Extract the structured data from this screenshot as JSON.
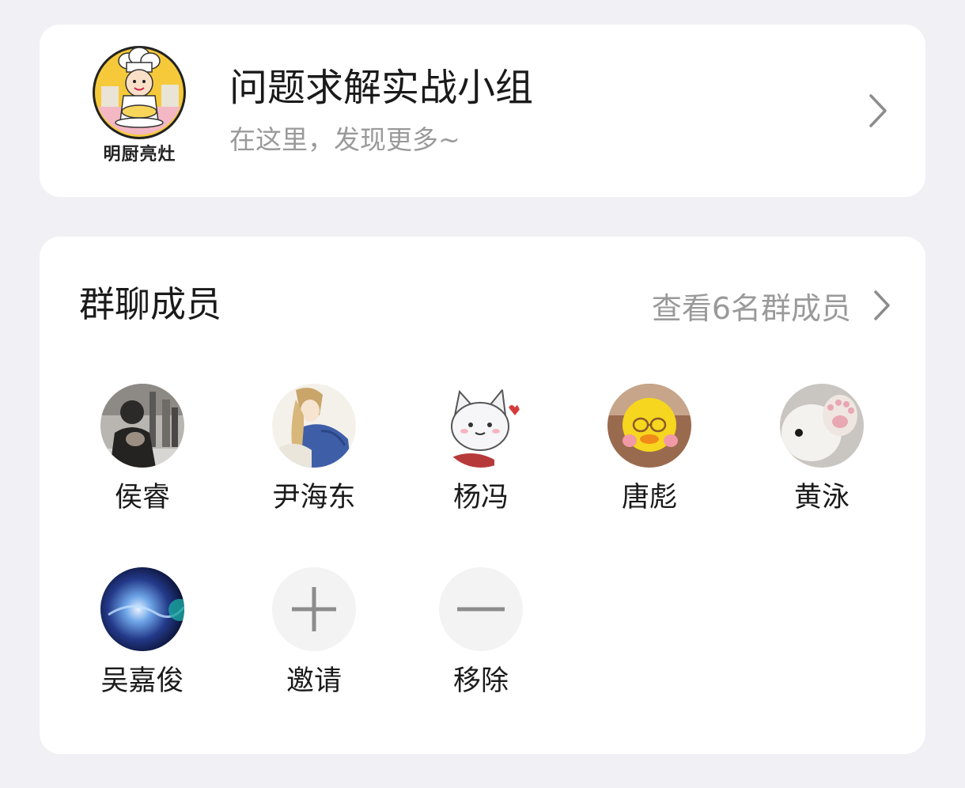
{
  "group": {
    "logo_text": "明厨亮灶",
    "name": "问题求解实战小组",
    "subtitle": "在这里，发现更多~",
    "chevron_icon": "chevron-right-icon"
  },
  "members_section": {
    "title": "群聊成员",
    "view_all_label": "查看6名群成员",
    "chevron_icon": "chevron-right-icon"
  },
  "members": [
    {
      "name": "侯睿",
      "avatar": "photo-avatar"
    },
    {
      "name": "尹海东",
      "avatar": "illustration-avatar"
    },
    {
      "name": "杨冯",
      "avatar": "cartoon-cat-avatar"
    },
    {
      "name": "唐彪",
      "avatar": "yellow-duck-avatar"
    },
    {
      "name": "黄泳",
      "avatar": "cat-paw-avatar"
    },
    {
      "name": "吴嘉俊",
      "avatar": "galaxy-avatar"
    }
  ],
  "actions": [
    {
      "label": "邀请",
      "icon": "plus-icon"
    },
    {
      "label": "移除",
      "icon": "minus-icon"
    }
  ],
  "colors": {
    "background": "#f0f0f5",
    "card": "#ffffff",
    "primary_text": "#1a1a1a",
    "secondary_text": "#9a9a9a",
    "action_circle": "#f3f3f3",
    "action_glyph": "#8c8c8c"
  }
}
